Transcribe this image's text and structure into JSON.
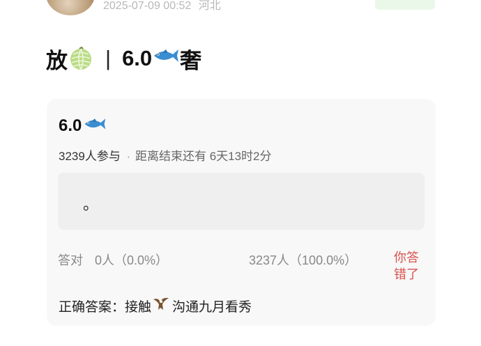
{
  "header": {
    "timestamp": "2025-07-09 00:52",
    "location": "河北"
  },
  "post": {
    "title_prefix": "放",
    "title_separator": "|",
    "title_number": "6.0",
    "title_suffix": "奢",
    "icons": [
      "melon-icon",
      "fish-icon"
    ]
  },
  "quiz": {
    "title": "6.0",
    "participants": "3239人参与",
    "separator": "·",
    "remaining": "距离结束还有 6天13时2分",
    "option_text": "。",
    "correct_label": "答对",
    "correct_count": "0人（0.0%）",
    "wrong_count": "3237人（100.0%）",
    "verdict": "你答错了",
    "answer_label": "正确答案：",
    "answer_part1": "接触",
    "answer_part2": "沟通九月看秀"
  },
  "colors": {
    "verdict": "#d9534f",
    "card_bg": "#f8f8f8",
    "option_bg": "#efefef",
    "meta_text": "#b8b8b8",
    "follow_bg": "#eaf8ea"
  }
}
